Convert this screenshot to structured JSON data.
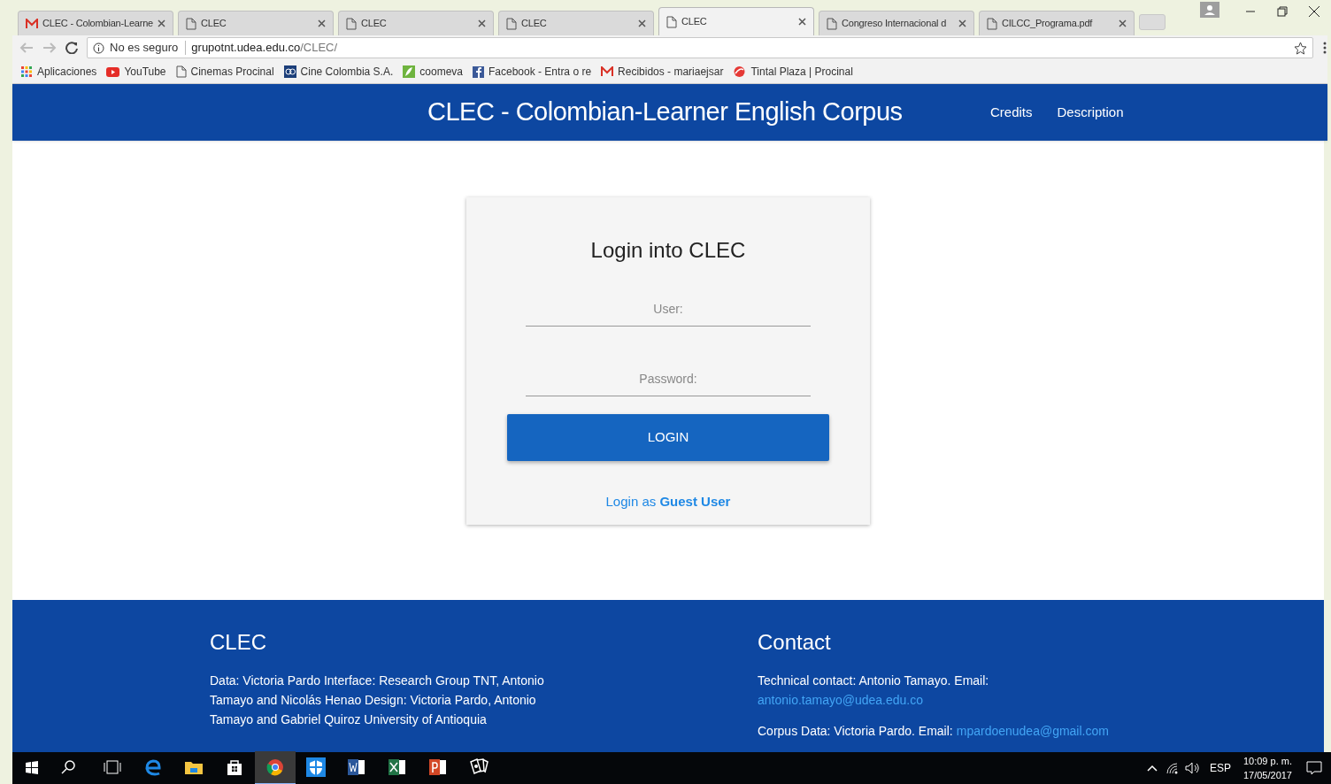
{
  "browser": {
    "tabs": [
      {
        "label": "CLEC - Colombian-Learne",
        "kind": "mail",
        "selected": false
      },
      {
        "label": "CLEC",
        "kind": "doc",
        "selected": false
      },
      {
        "label": "CLEC",
        "kind": "doc",
        "selected": false
      },
      {
        "label": "CLEC",
        "kind": "doc",
        "selected": false
      },
      {
        "label": "CLEC",
        "kind": "doc",
        "selected": true
      },
      {
        "label": "Congreso Internacional d",
        "kind": "doc",
        "selected": false
      },
      {
        "label": "CILCC_Programa.pdf",
        "kind": "doc",
        "selected": false
      }
    ],
    "security": "No es seguro",
    "url_host": "grupotnt.udea.edu.co",
    "url_path": "/CLEC/",
    "bookmarks": [
      {
        "label": "Aplicaciones",
        "kind": "apps"
      },
      {
        "label": "YouTube",
        "kind": "video"
      },
      {
        "label": "Cinemas Procinal",
        "kind": "doc"
      },
      {
        "label": "Cine Colombia S.A.",
        "kind": "cc"
      },
      {
        "label": "coomeva",
        "kind": "leaf"
      },
      {
        "label": "Facebook - Entra o re",
        "kind": "fb"
      },
      {
        "label": "Recibidos - mariaejsar",
        "kind": "mail"
      },
      {
        "label": "Tintal Plaza | Procinal",
        "kind": "swirl"
      }
    ]
  },
  "header": {
    "title": "CLEC - Colombian-Learner English Corpus",
    "nav": [
      "Credits",
      "Description"
    ]
  },
  "login": {
    "title": "Login into CLEC",
    "user_placeholder": "User:",
    "password_placeholder": "Password:",
    "button": "LOGIN",
    "guest_link": "Login as **Guest User**"
  },
  "footer": {
    "left_title": "CLEC",
    "left_text": "Data: Victoria Pardo Interface: Research Group TNT, Antonio Tamayo and Nicolás Henao Design: Victoria Pardo, Antonio Tamayo and Gabriel Quiroz University of Antioquia",
    "right_title": "Contact",
    "technical_text": "Technical contact: Antonio Tamayo. Email:",
    "technical_email": "antonio.tamayo@udea.edu.co",
    "corpus_text": "Corpus Data: Victoria Pardo. Email:",
    "corpus_email": "mpardoenudea@gmail.com"
  },
  "taskbar": {
    "apps": [
      {
        "kind": "search",
        "selected": false
      },
      {
        "kind": "taskview",
        "selected": false
      },
      {
        "kind": "edge",
        "selected": false
      },
      {
        "kind": "folder",
        "selected": false
      },
      {
        "kind": "store",
        "selected": false
      },
      {
        "kind": "chrome",
        "selected": true
      },
      {
        "kind": "shield",
        "selected": false
      },
      {
        "kind": "word",
        "selected": false
      },
      {
        "kind": "excel",
        "selected": false
      },
      {
        "kind": "powerpoint",
        "selected": false
      },
      {
        "kind": "cards",
        "selected": false
      }
    ],
    "language": "ESP",
    "time": "10:09 p. m.",
    "date": "17/05/2017"
  }
}
